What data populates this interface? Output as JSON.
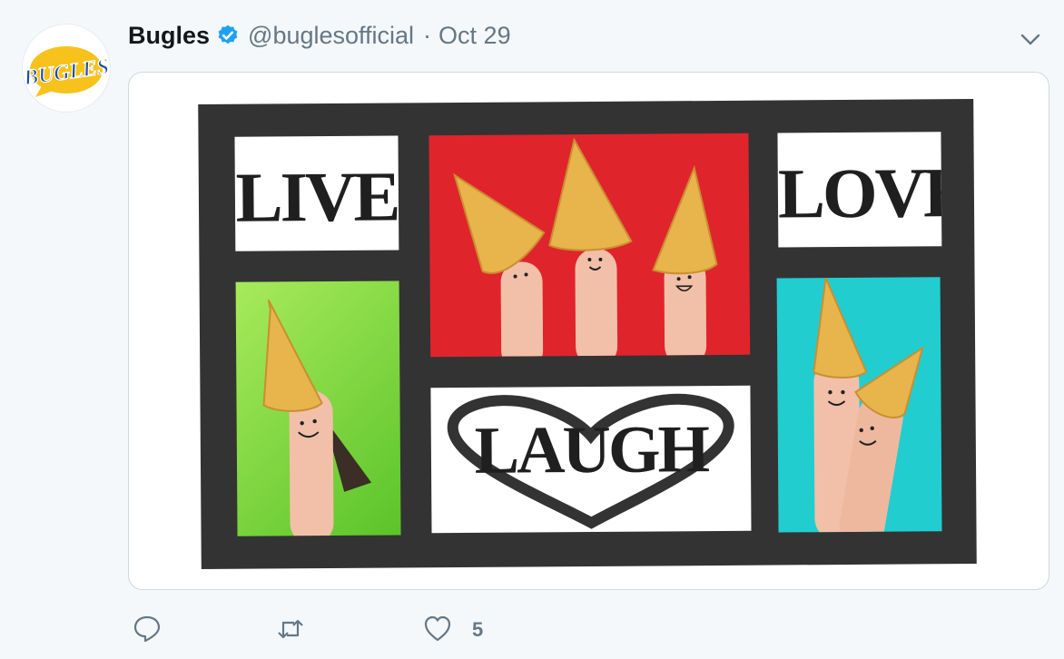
{
  "tweet": {
    "author_name": "Bugles",
    "handle": "@buglesofficial",
    "separator": "·",
    "date": "Oct 29",
    "avatar_logo_text": "BUGLES",
    "verified": true
  },
  "media": {
    "words": {
      "top_left": "LIVE",
      "top_right": "LOVE",
      "center": "LAUGH"
    }
  },
  "actions": {
    "reply_count": "",
    "retweet_count": "",
    "like_count": "5"
  },
  "colors": {
    "link_blue": "#1da1f2",
    "secondary_text": "#657786",
    "frame": "#333333",
    "bugle_gold": "#e8b44c",
    "panel_red": "#e0242c",
    "panel_green": "#8edc3c",
    "panel_teal": "#22cdd0"
  },
  "icons": [
    "verified-badge-icon",
    "chevron-down-icon",
    "reply-icon",
    "retweet-icon",
    "like-icon"
  ]
}
